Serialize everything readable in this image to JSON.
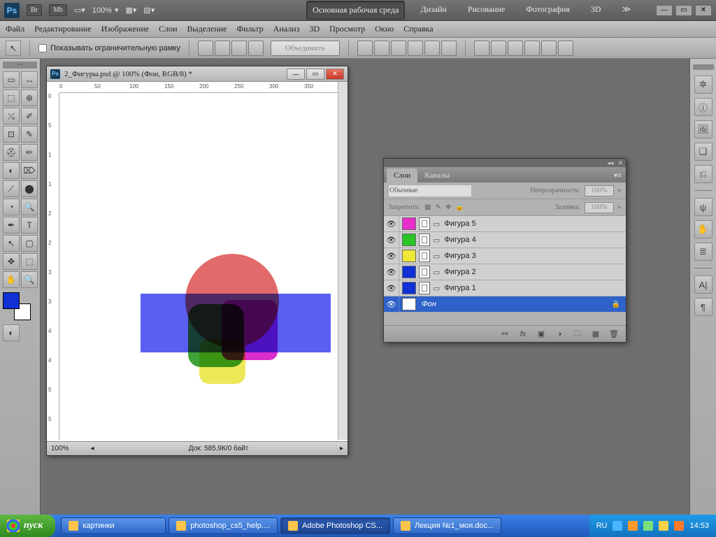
{
  "titlebar": {
    "ps": "Ps",
    "br": "Br",
    "mb": "Mb",
    "zoom": "100%",
    "workspaces": [
      "Основная рабочая среда",
      "Дизайн",
      "Рисование",
      "Фотография",
      "3D"
    ],
    "ws_active": 0,
    "expand": "≫"
  },
  "menu": [
    "Файл",
    "Редактирование",
    "Изображение",
    "Слои",
    "Выделение",
    "Фильтр",
    "Анализ",
    "3D",
    "Просмотр",
    "Окно",
    "Справка"
  ],
  "optionbar": {
    "checkbox": "Показывать ограничительную рамку",
    "merge": "Объединить"
  },
  "document": {
    "title": "2_Фигуры.psd @ 100% (Фон, RGB/8) *",
    "zoom": "100%",
    "status": "Док: 585,9К/0 байт",
    "hruler": [
      "0",
      "50",
      "100",
      "150",
      "200",
      "250",
      "300",
      "350"
    ],
    "vruler": [
      "0",
      "5",
      "1",
      "1",
      "2",
      "2",
      "3",
      "3",
      "4",
      "4",
      "5",
      "5"
    ]
  },
  "layers_panel": {
    "tabs": [
      "Слои",
      "Каналы"
    ],
    "tab_active": 0,
    "mode": "Обычные",
    "opacity_label": "Непрозрачность:",
    "opacity": "100%",
    "lock_label": "Закрепить:",
    "fill_label": "Заливка:",
    "fill": "100%",
    "layers": [
      {
        "name": "Фигура 5",
        "color": "#e82fcb"
      },
      {
        "name": "Фигура 4",
        "color": "#28c428"
      },
      {
        "name": "Фигура 3",
        "color": "#f0e838"
      },
      {
        "name": "Фигура 2",
        "color": "#1231d4"
      },
      {
        "name": "Фигура 1",
        "color": "#1231d4"
      }
    ],
    "bg_layer": "Фон",
    "bg_locked": "🔒"
  },
  "rightdock": [
    "✲",
    "ⓘ",
    "🖼",
    "❏",
    "⎌",
    "—",
    "ψ",
    "✋",
    "≣",
    "—",
    "A|",
    "¶"
  ],
  "taskbar": {
    "start": "пуск",
    "tasks": [
      {
        "label": "картинки"
      },
      {
        "label": "photoshop_cs5_help...."
      },
      {
        "label": "Adobe Photoshop CS...",
        "active": true
      },
      {
        "label": "Лекция №1_моя.doc..."
      }
    ],
    "lang": "RU",
    "time": "14:53"
  },
  "tools": [
    "▭",
    "↔",
    "⬚",
    "⊕",
    "⤯",
    "✐",
    "⊡",
    "✎",
    "⛑",
    "✏",
    "◐",
    "⌦",
    "⟋",
    "⬤",
    "◔",
    "🔍",
    "✒",
    "T",
    "↖",
    "▢",
    "✥",
    "⬚",
    "✋",
    "🔍"
  ]
}
